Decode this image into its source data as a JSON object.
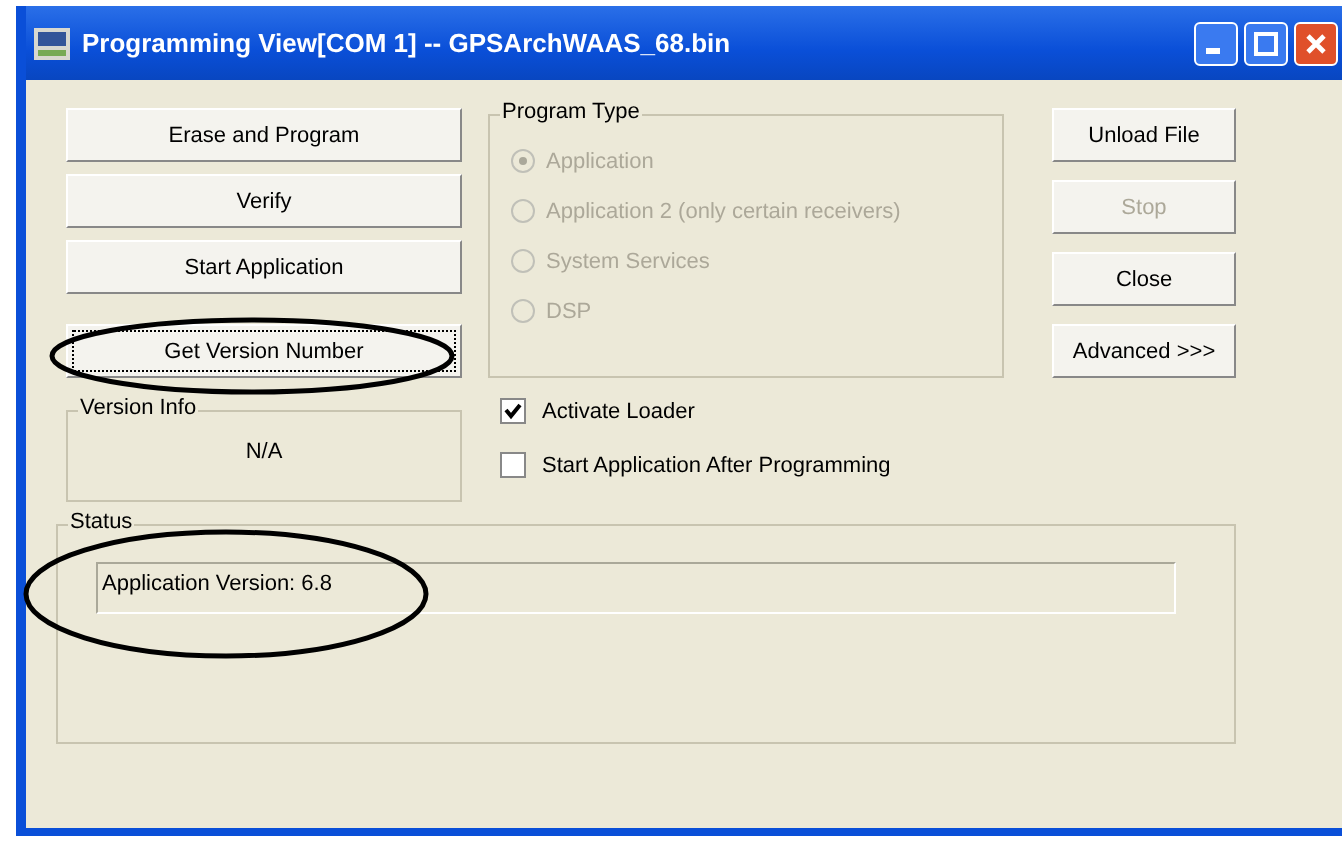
{
  "window": {
    "title": "Programming View[COM 1] -- GPSArchWAAS_68.bin"
  },
  "left_buttons": [
    {
      "label": "Erase and Program",
      "focused": false
    },
    {
      "label": "Verify",
      "focused": false
    },
    {
      "label": "Start Application",
      "focused": false
    },
    {
      "label": "Get Version Number",
      "focused": true
    }
  ],
  "version_info": {
    "label": "Version Info",
    "value": "N/A"
  },
  "program_type": {
    "label": "Program Type",
    "options": [
      {
        "label": "Application",
        "selected": true,
        "disabled": true
      },
      {
        "label": "Application 2 (only certain receivers)",
        "selected": false,
        "disabled": true
      },
      {
        "label": "System Services",
        "selected": false,
        "disabled": true
      },
      {
        "label": "DSP",
        "selected": false,
        "disabled": true
      }
    ]
  },
  "checkboxes": [
    {
      "label": "Activate Loader",
      "checked": true
    },
    {
      "label": "Start Application After Programming",
      "checked": false
    }
  ],
  "right_buttons": [
    {
      "label": "Unload File",
      "disabled": false
    },
    {
      "label": "Stop",
      "disabled": true
    },
    {
      "label": "Close",
      "disabled": false
    },
    {
      "label": "Advanced >>>",
      "disabled": false
    }
  ],
  "status": {
    "label": "Status",
    "value": "Application Version: 6.8"
  }
}
